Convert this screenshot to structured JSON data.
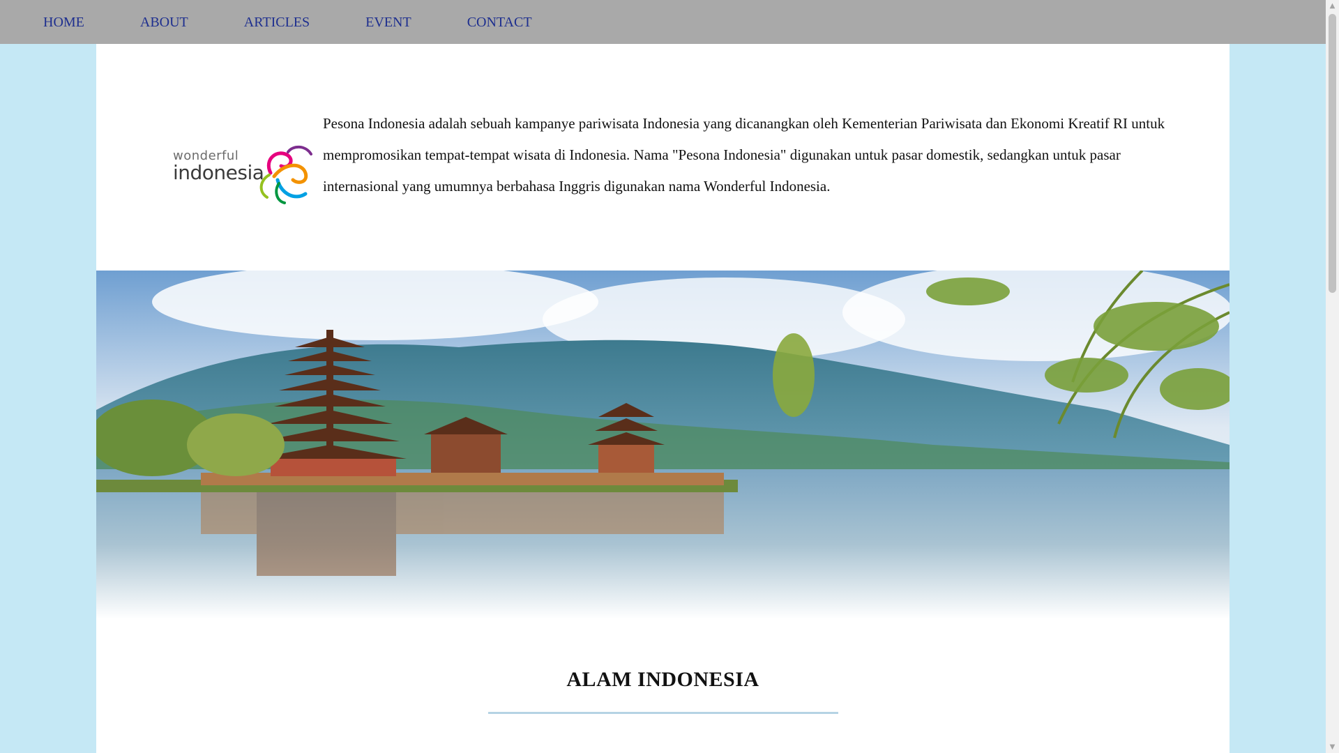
{
  "nav": {
    "items": [
      {
        "label": "HOME"
      },
      {
        "label": "ABOUT"
      },
      {
        "label": "ARTICLES"
      },
      {
        "label": "EVENT"
      },
      {
        "label": "CONTACT"
      }
    ]
  },
  "intro": {
    "logo_line1": "wonderful",
    "logo_line2": "indonesia",
    "text": "Pesona Indonesia adalah sebuah kampanye pariwisata Indonesia yang dicanangkan oleh Kementerian Pariwisata dan Ekonomi Kreatif RI untuk mempromosikan tempat-tempat wisata di Indonesia. Nama \"Pesona Indonesia\" digunakan untuk pasar domestik, sedangkan untuk pasar internasional yang umumnya berbahasa Inggris digunakan nama Wonderful Indonesia."
  },
  "hero": {
    "image": "bali-temple-lake-landscape"
  },
  "section": {
    "title": "ALAM INDONESIA"
  },
  "colors": {
    "page_background": "#c5e8f5",
    "navbar": "#a9a9a9",
    "nav_link": "#1e2f8f",
    "title_underline": "#b5d3e4"
  }
}
